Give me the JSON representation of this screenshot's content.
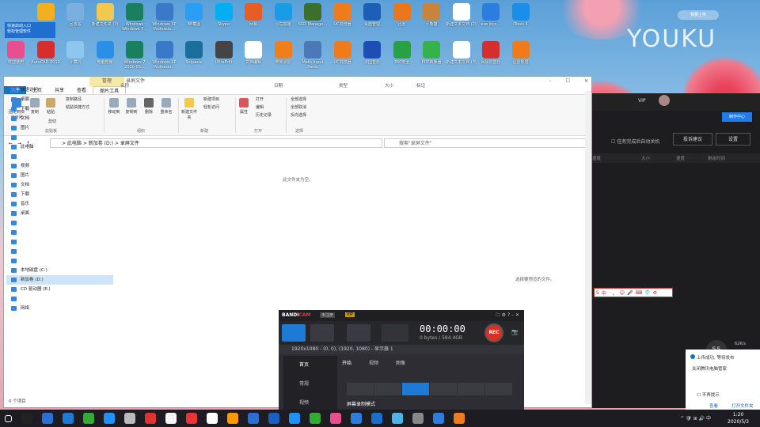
{
  "desktop": {
    "row1": [
      {
        "label": "快速启动入口",
        "color": "#1e5bb8"
      },
      {
        "label": "软件管家",
        "color": "#f2b01e"
      },
      {
        "label": "回收站",
        "color": "#7ab0e0"
      },
      {
        "label": "新建文件夹 (3)",
        "color": "#f2c94c"
      },
      {
        "label": "Windows Windows 7...",
        "color": "#1a7f5e"
      },
      {
        "label": "Windows XP Professio...",
        "color": "#3a78c8"
      },
      {
        "label": "BB截图",
        "color": "#2a9df4"
      },
      {
        "label": "Skype",
        "color": "#00aff0"
      },
      {
        "label": "网易",
        "color": "#e85d24"
      },
      {
        "label": "小鸟加速",
        "color": "#1a9be6"
      },
      {
        "label": "SSD Manage...",
        "color": "#3c6e2c"
      },
      {
        "label": "UC浏览器",
        "color": "#f07b1a"
      },
      {
        "label": "桌面管理",
        "color": "#1d5fb5"
      },
      {
        "label": "迅雷",
        "color": "#e8771e"
      },
      {
        "label": "小熊猫",
        "color": "#c7843a"
      },
      {
        "label": "新建文本文档 (2)",
        "color": "#ffffff"
      },
      {
        "label": "exe 网页...",
        "color": "#2b7de0"
      },
      {
        "label": "iTools 4",
        "color": "#1a8ee8"
      }
    ],
    "row2": [
      {
        "label": "欢迎使用",
        "color": "#e94f8f"
      },
      {
        "label": "AutoCAD 2019",
        "color": "#d62d2d"
      },
      {
        "label": "计算机",
        "color": "#8ec6ef"
      },
      {
        "label": "电脑管家",
        "color": "#2a8fe8"
      },
      {
        "label": "Windows 7 2020-05...",
        "color": "#1a7f5e"
      },
      {
        "label": "Windows XP Professio...",
        "color": "#3a78c8"
      },
      {
        "label": "Snipaste",
        "color": "#1a6e9c"
      },
      {
        "label": "UltraEdit",
        "color": "#444444"
      },
      {
        "label": "文档编辑",
        "color": "#ffffff"
      },
      {
        "label": "苹果录屏",
        "color": "#f07e1a"
      },
      {
        "label": "Math Input Panel",
        "color": "#4a78b8"
      },
      {
        "label": "UC浏览器",
        "color": "#f07b1a"
      },
      {
        "label": "法国音乐",
        "color": "#1d4db5"
      },
      {
        "label": "360安全",
        "color": "#2aa044"
      },
      {
        "label": "PDF转换器",
        "color": "#35b34a"
      },
      {
        "label": "新建文本文档 (3)",
        "color": "#ffffff"
      },
      {
        "label": "网易云音乐",
        "color": "#d62d2d"
      },
      {
        "label": "迅雷影音",
        "color": "#f07b1a"
      }
    ],
    "quick_access_line1": "快速启动入口",
    "quick_access_line2": "轻松管理软件",
    "youku_logo": "YOUKU",
    "youku_upload": "我要上传"
  },
  "explorer": {
    "manage_tab": "管理",
    "title": "录屏文件",
    "tabs": [
      "文件",
      "主页",
      "共享",
      "查看",
      "图片工具"
    ],
    "ribbon": {
      "pin": "固定到快速访问",
      "copy": "复制",
      "paste": "粘贴",
      "copy_path": "复制路径",
      "paste_shortcut": "粘贴快捷方式",
      "cut": "剪切",
      "clipboard": "剪贴板",
      "move_to": "移动到",
      "copy_to": "复制到",
      "delete": "删除",
      "rename": "重命名",
      "organize": "组织",
      "new_folder": "新建文件夹",
      "new_item": "新建项目",
      "easy_access": "轻松访问",
      "new": "新建",
      "properties": "属性",
      "open": "打开",
      "edit": "编辑",
      "history": "历史记录",
      "open_group": "打开",
      "select_all": "全部选择",
      "select_none": "全部取消",
      "invert": "反向选择",
      "select": "选择"
    },
    "breadcrumb": [
      "此电脑",
      "新加卷 (D:)",
      "录屏文件"
    ],
    "search_placeholder": "搜索\"录屏文件\"",
    "nav": [
      {
        "label": "快速访问",
        "sel": false
      },
      {
        "label": "桌面",
        "sel": false
      },
      {
        "label": "下载",
        "sel": false
      },
      {
        "label": "文档",
        "sel": false
      },
      {
        "label": "图片",
        "sel": false
      },
      {
        "label": "",
        "sel": false
      },
      {
        "label": "此电脑",
        "sel": false
      },
      {
        "label": "",
        "sel": false
      },
      {
        "label": "视频",
        "sel": false
      },
      {
        "label": "图片",
        "sel": false
      },
      {
        "label": "文档",
        "sel": false
      },
      {
        "label": "下载",
        "sel": false
      },
      {
        "label": "音乐",
        "sel": false
      },
      {
        "label": "桌面",
        "sel": false
      },
      {
        "label": "",
        "sel": false
      },
      {
        "label": "",
        "sel": false
      },
      {
        "label": "",
        "sel": false
      },
      {
        "label": "",
        "sel": false
      },
      {
        "label": "",
        "sel": false
      },
      {
        "label": "本地磁盘 (C:)",
        "sel": false
      },
      {
        "label": "新加卷 (D:)",
        "sel": true
      },
      {
        "label": "CD 驱动器 (E:)",
        "sel": false
      },
      {
        "label": "",
        "sel": false
      },
      {
        "label": "网络",
        "sel": false
      }
    ],
    "columns": [
      "名称",
      "日期",
      "类型",
      "大小",
      "标记"
    ],
    "empty_text": "此文件夹为空。",
    "preview_text": "选择要预览的文件。",
    "status": "0 个项目"
  },
  "youku_panel": {
    "vip": "VIP",
    "upload_center": "制作中心",
    "auto_shutdown": "任务完成后自动关机",
    "feedback": "投诉建议",
    "settings": "设置",
    "cols": [
      "速度",
      "大小",
      "速度",
      "剩余时间"
    ]
  },
  "sogou": [
    "S",
    "中",
    "·",
    "。",
    "☺",
    "🎤",
    "⌨",
    "👕",
    "⚙"
  ],
  "bandicam": {
    "logo_a": "BANDI",
    "logo_b": "CAM",
    "trial": "未注册",
    "vip": "VIP",
    "time": "00:00:00",
    "size": "0 bytes / 584.4GB",
    "rec": "REC",
    "resolution": "1920x1080 - (0, 0), (1920, 1080) - 显示器 1",
    "side": [
      "首页",
      "常规",
      "视频"
    ],
    "tabs": [
      "开始",
      "视频",
      "图像"
    ],
    "bottom_text": "屏幕录制模式"
  },
  "notification": {
    "title": "上传成功, 等待发布",
    "body": "关闭腾讯电脑管家",
    "no_show": "不再提示",
    "view": "查看",
    "open_folder": "打开文件夹",
    "badge": "55",
    "speed": "62K/s"
  },
  "taskbar": {
    "time": "1:20",
    "date": "2020/5/3",
    "tray": "^ 🛡 ⊞ 🔊 中"
  }
}
